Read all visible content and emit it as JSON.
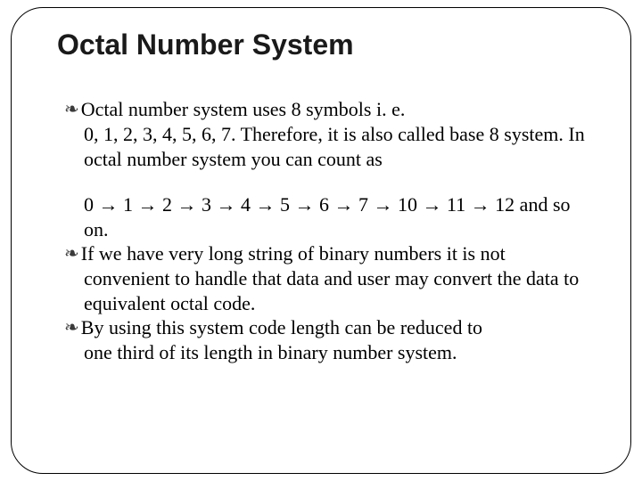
{
  "title": "Octal Number System",
  "bullets": {
    "b1_lead": "Octal number system uses 8 symbols i. e.",
    "b1_cont": "0, 1, 2, 3, 4, 5, 6, 7. Therefore, it is also called base 8 system. In octal number system you can count as",
    "seq_line": " 0 → 1 → 2 → 3 → 4 → 5 → 6 → 7 → 10 → 11 → 12 and so",
    "seq_cont": "on.",
    "b2_lead": "If we have very long string of binary numbers it is not",
    "b2_cont": "convenient to handle that data and user may convert the data to equivalent octal code.",
    "b3_lead": "By using this system code length can be reduced to",
    "b3_cont": "one third of its length in binary number system."
  }
}
